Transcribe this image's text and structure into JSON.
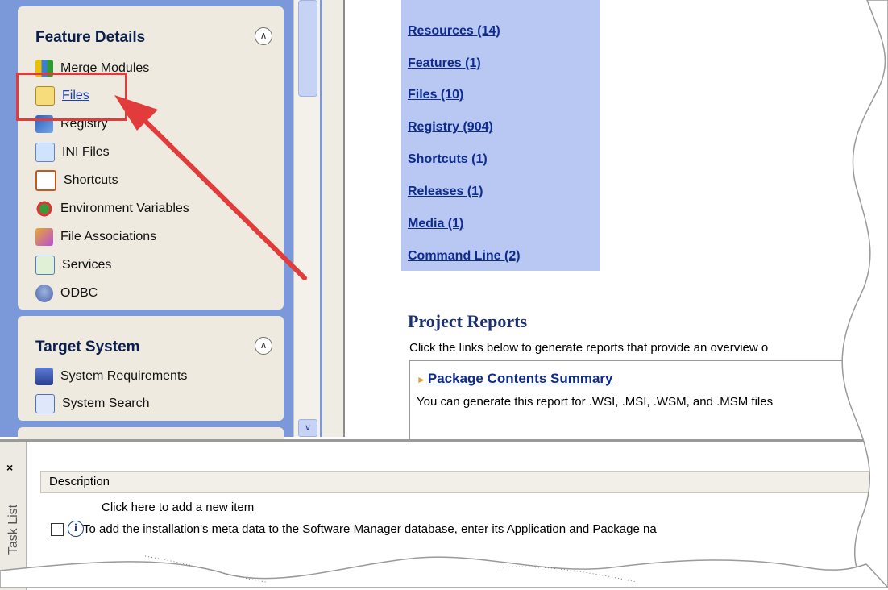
{
  "feature_details": {
    "title": "Feature Details",
    "items": [
      {
        "label": "Merge Modules",
        "icon": "merge-modules-icon"
      },
      {
        "label": "Files",
        "icon": "files-icon"
      },
      {
        "label": "Registry",
        "icon": "registry-icon"
      },
      {
        "label": "INI Files",
        "icon": "ini-files-icon"
      },
      {
        "label": "Shortcuts",
        "icon": "shortcuts-icon"
      },
      {
        "label": "Environment Variables",
        "icon": "environment-variables-icon"
      },
      {
        "label": "File Associations",
        "icon": "file-associations-icon"
      },
      {
        "label": "Services",
        "icon": "services-icon"
      },
      {
        "label": "ODBC",
        "icon": "odbc-icon"
      }
    ]
  },
  "target_system": {
    "title": "Target System",
    "items": [
      {
        "label": "System Requirements",
        "icon": "system-requirements-icon"
      },
      {
        "label": "System Search",
        "icon": "system-search-icon"
      }
    ]
  },
  "summary_links": [
    "Resources (14)",
    "Features (1)",
    "Files (10)",
    "Registry (904)",
    "Shortcuts (1)",
    "Releases (1)",
    "Media (1)",
    "Command Line (2)"
  ],
  "project_reports": {
    "title": "Project Reports",
    "description": "Click the links below to generate reports that provide an overview o",
    "report_link": "Package Contents Summary",
    "report_description": "You can generate this report for .WSI, .MSI, .WSM, and .MSM files"
  },
  "task_list": {
    "tab_label": "Task List",
    "close_glyph": "×",
    "column_header": "Description",
    "add_item": "Click here to add a new item",
    "rows": [
      {
        "text": "To add the installation's meta data to the Software Manager database, enter its Application and Package na",
        "checked": false
      }
    ]
  },
  "colors": {
    "pane_background": "#7b98d8",
    "group_background": "#eeeadf",
    "links_panel": "#b8c8f2",
    "link": "#0e2b8f",
    "annotation": "#e23b3b"
  }
}
